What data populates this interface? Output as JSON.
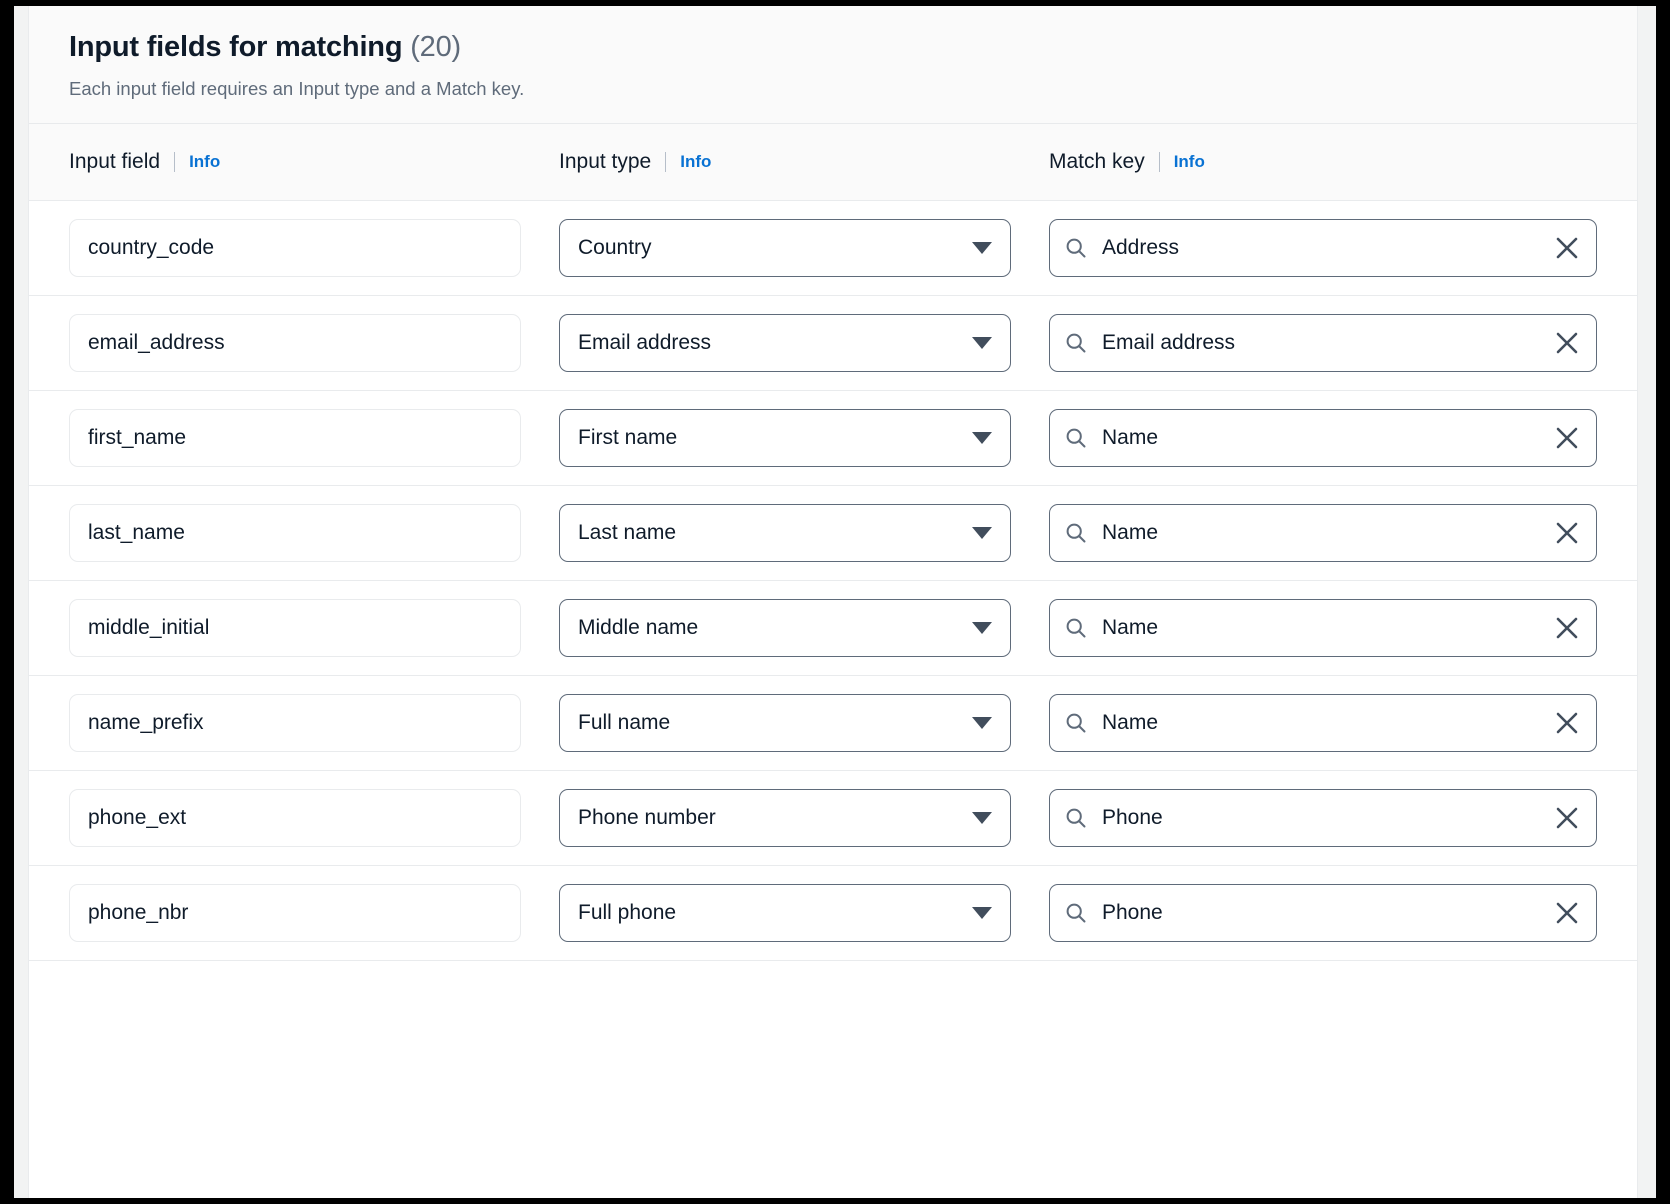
{
  "panel": {
    "title": "Input fields for matching",
    "count": "(20)",
    "subtitle": "Each input field requires an Input type and a Match key."
  },
  "columns": {
    "input_field": {
      "label": "Input field",
      "info": "Info"
    },
    "input_type": {
      "label": "Input type",
      "info": "Info"
    },
    "match_key": {
      "label": "Match key",
      "info": "Info"
    }
  },
  "icons": {
    "search": "search-icon",
    "clear": "close-icon",
    "chevron": "chevron-down-icon"
  },
  "colors": {
    "link": "#0972d3",
    "text": "#0f1b2a",
    "muted": "#5f6b7a",
    "border": "#5f6b7a",
    "light_border": "#e9ebed",
    "header_bg": "#fafafa"
  },
  "rows": [
    {
      "input_field": "country_code",
      "input_type": "Country",
      "match_key": "Address"
    },
    {
      "input_field": "email_address",
      "input_type": "Email address",
      "match_key": "Email address"
    },
    {
      "input_field": "first_name",
      "input_type": "First name",
      "match_key": "Name"
    },
    {
      "input_field": "last_name",
      "input_type": "Last name",
      "match_key": "Name"
    },
    {
      "input_field": "middle_initial",
      "input_type": "Middle name",
      "match_key": "Name"
    },
    {
      "input_field": "name_prefix",
      "input_type": "Full name",
      "match_key": "Name"
    },
    {
      "input_field": "phone_ext",
      "input_type": "Phone number",
      "match_key": "Phone"
    },
    {
      "input_field": "phone_nbr",
      "input_type": "Full phone",
      "match_key": "Phone"
    }
  ]
}
